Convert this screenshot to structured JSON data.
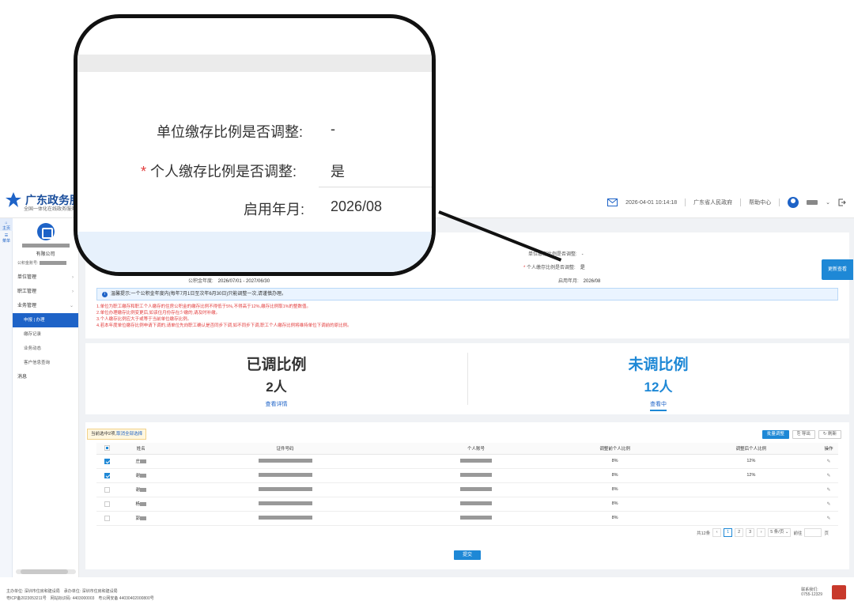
{
  "header": {
    "brand": "广东政务服务",
    "slogan": "全国一体化在线政务服务",
    "datetime": "2026-04-01 10:14:18",
    "gov_link": "广东省人民政府",
    "help": "帮助中心"
  },
  "rail": {
    "home": "主页",
    "menu": "菜单"
  },
  "sidebar": {
    "company": "有限公司",
    "account_label": "公积金账号:",
    "items": [
      {
        "label": "单位管理"
      },
      {
        "label": "职工管理"
      },
      {
        "label": "业务管理"
      }
    ],
    "subitems": [
      {
        "label": "申报 | 办理"
      },
      {
        "label": "缴存记录"
      },
      {
        "label": "业务动态"
      },
      {
        "label": "客户信息查询"
      }
    ],
    "messages": "消息"
  },
  "form": {
    "unit_adjust_label": "单位缴存比例是否调整:",
    "unit_adjust_value": "-",
    "personal_adjust_label": "个人缴存比例是否调整:",
    "personal_adjust_value": "是",
    "required_mark": "*",
    "year_label": "公积金年度:",
    "year_value": "2026/07/01 - 2027/06/30",
    "start_label": "启用年月:",
    "start_value": "2026/08"
  },
  "tip": "温馨提示:一个公积金年度内(每年7月1日至次年6月30日)只能调整一次,请谨慎办理。",
  "rules": [
    "1.单位为职工缴存和职工个人缴存的住房公积金的缴存比例不得低于5%,不得高于12%,缴存比例取1%的整数值。",
    "2.单位办理缴存比例变更后,如该住月份存在少缴的,请及时补缴。",
    "3.个人缴存比例应大于或等于当前单位缴存比例。",
    "4.若本年度单位缴存比例申请下调的,请单位先向职工确认是否同步下调,如不同步下调,职工个人缴存比例将维持单位下调前的原比例。"
  ],
  "stats": {
    "adjusted_title": "已调比例",
    "adjusted_count": "2人",
    "adjusted_link": "查看详情",
    "pending_title": "未调比例",
    "pending_count": "12人",
    "pending_link": "查看中"
  },
  "table_panel": {
    "selected_note": "当前选中2项,",
    "cancel_link": "取消全部选择",
    "batch_btn": "批量调整",
    "export_btn": "导出",
    "refresh_btn": "刷新",
    "columns": [
      "姓名",
      "证件号码",
      "个人账号",
      "调整前个人比例",
      "调整后个人比例",
      "操作"
    ],
    "rows": [
      {
        "name": "庄",
        "before": "8%",
        "after": "12%",
        "checked": true
      },
      {
        "name": "谢",
        "before": "8%",
        "after": "12%",
        "checked": true
      },
      {
        "name": "谢",
        "before": "8%",
        "after": "",
        "checked": false
      },
      {
        "name": "杨",
        "before": "8%",
        "after": "",
        "checked": false
      },
      {
        "name": "郭",
        "before": "8%",
        "after": "",
        "checked": false
      }
    ],
    "total": "共12条",
    "pages": [
      "1",
      "2",
      "3"
    ],
    "page_size": "5 条/页",
    "jump_label": "前往",
    "page_unit": "页",
    "submit": "提交"
  },
  "float_btn": "更新查看",
  "footer": {
    "sponsor": "主办单位: 深圳市住房和建设局",
    "operator": "承办单位: 深圳市住房和建设局",
    "icp": "粤ICP备2023053211号",
    "site_id": "网站标识码: 4403000003",
    "police": "粤公网安备 44030402000800号",
    "contact_label": "联系我们:",
    "hotline": "0755-12329"
  },
  "magnifier": {
    "unit_label": "单位缴存比例是否调整:",
    "unit_value": "-",
    "personal_label": "个人缴存比例是否调整:",
    "personal_value": "是",
    "required_mark": "*",
    "start_label": "启用年月:",
    "start_value": "2026/08"
  }
}
